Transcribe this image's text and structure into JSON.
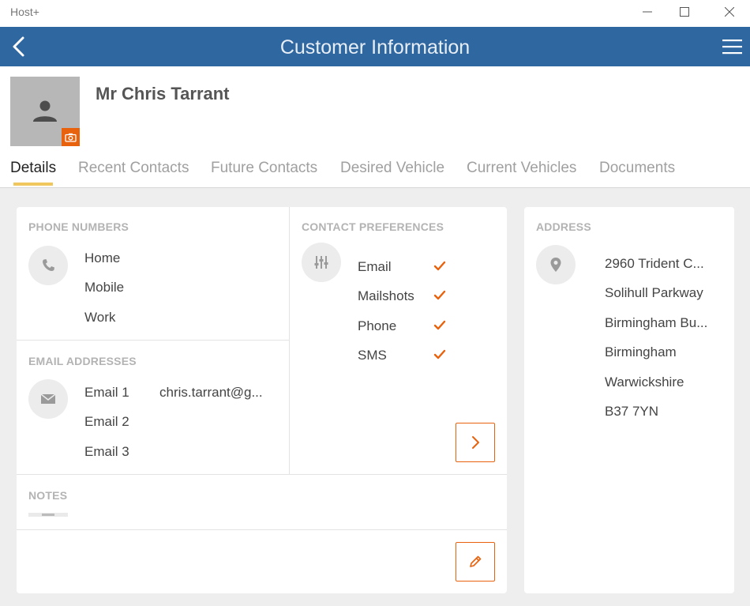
{
  "window": {
    "app_name": "Host+"
  },
  "header": {
    "title": "Customer Information"
  },
  "customer": {
    "name": "Mr Chris Tarrant"
  },
  "tabs": [
    {
      "label": "Details"
    },
    {
      "label": "Recent Contacts"
    },
    {
      "label": "Future Contacts"
    },
    {
      "label": "Desired Vehicle"
    },
    {
      "label": "Current Vehicles"
    },
    {
      "label": "Documents"
    }
  ],
  "active_tab": "Details",
  "phone": {
    "label": "PHONE NUMBERS",
    "items": [
      "Home",
      "Mobile",
      "Work"
    ]
  },
  "email": {
    "label": "EMAIL ADDRESSES",
    "items": [
      {
        "label": "Email 1",
        "value": "chris.tarrant@g..."
      },
      {
        "label": "Email 2",
        "value": ""
      },
      {
        "label": "Email 3",
        "value": ""
      }
    ]
  },
  "preferences": {
    "label": "CONTACT PREFERENCES",
    "items": [
      {
        "label": "Email",
        "checked": true
      },
      {
        "label": "Mailshots",
        "checked": true
      },
      {
        "label": "Phone",
        "checked": true
      },
      {
        "label": "SMS",
        "checked": true
      }
    ]
  },
  "notes": {
    "label": "NOTES"
  },
  "address": {
    "label": "ADDRESS",
    "lines": [
      "2960 Trident C...",
      "Solihull Parkway",
      "Birmingham Bu...",
      "Birmingham",
      "Warwickshire",
      "B37 7YN"
    ]
  },
  "colors": {
    "header_bg": "#2f67a0",
    "accent": "#e8620e",
    "tab_indicator": "#f0c75e"
  },
  "icons": {
    "back": "chevron-left-icon",
    "menu": "hamburger-menu-icon",
    "camera": "camera-icon",
    "phone": "phone-icon",
    "email": "envelope-icon",
    "preferences": "sliders-icon",
    "address": "location-pin-icon",
    "next": "chevron-right-icon",
    "edit": "pencil-icon"
  }
}
